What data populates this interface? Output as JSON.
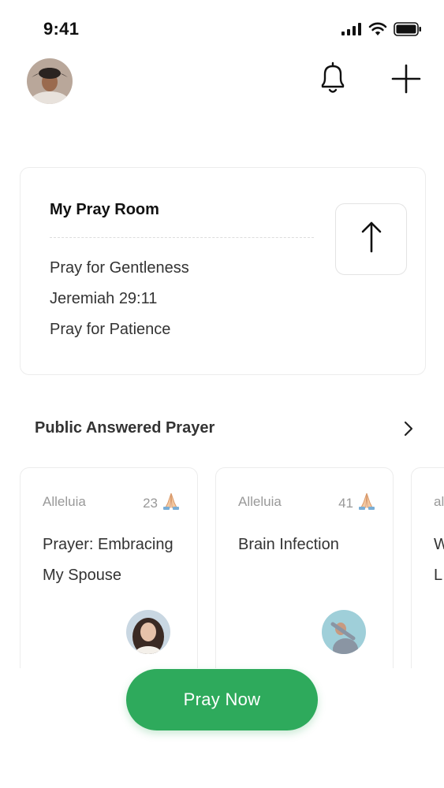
{
  "status_bar": {
    "time": "9:41",
    "icons": [
      "signal-icon",
      "wifi-icon",
      "battery-icon"
    ]
  },
  "header": {
    "avatar": "user-avatar",
    "icons": [
      "bell-icon",
      "plus-icon"
    ]
  },
  "pray_room": {
    "title": "My Pray Room",
    "items": [
      "Pray for Gentleness",
      "Jeremiah 29:11",
      "Pray for Patience"
    ],
    "action_icon": "arrow-up-icon"
  },
  "public_answered": {
    "title": "Public Answered Prayer",
    "chevron_icon": "chevron-right-icon",
    "cards": [
      {
        "tag": "Alleluia",
        "count": "23",
        "icon": "praying-hands-icon",
        "title": "Prayer: Embracing My Spouse",
        "avatar": "author-avatar"
      },
      {
        "tag": "Alleluia",
        "count": "41",
        "icon": "praying-hands-icon",
        "title": "Brain Infection",
        "avatar": "author-avatar"
      },
      {
        "tag": "al",
        "count": "",
        "icon": "",
        "title": "W L",
        "avatar": ""
      }
    ]
  },
  "cta": {
    "label": "Pray Now"
  },
  "colors": {
    "accent": "#2eaa5c",
    "text": "#333333",
    "muted": "#999999",
    "border": "#ececec"
  }
}
